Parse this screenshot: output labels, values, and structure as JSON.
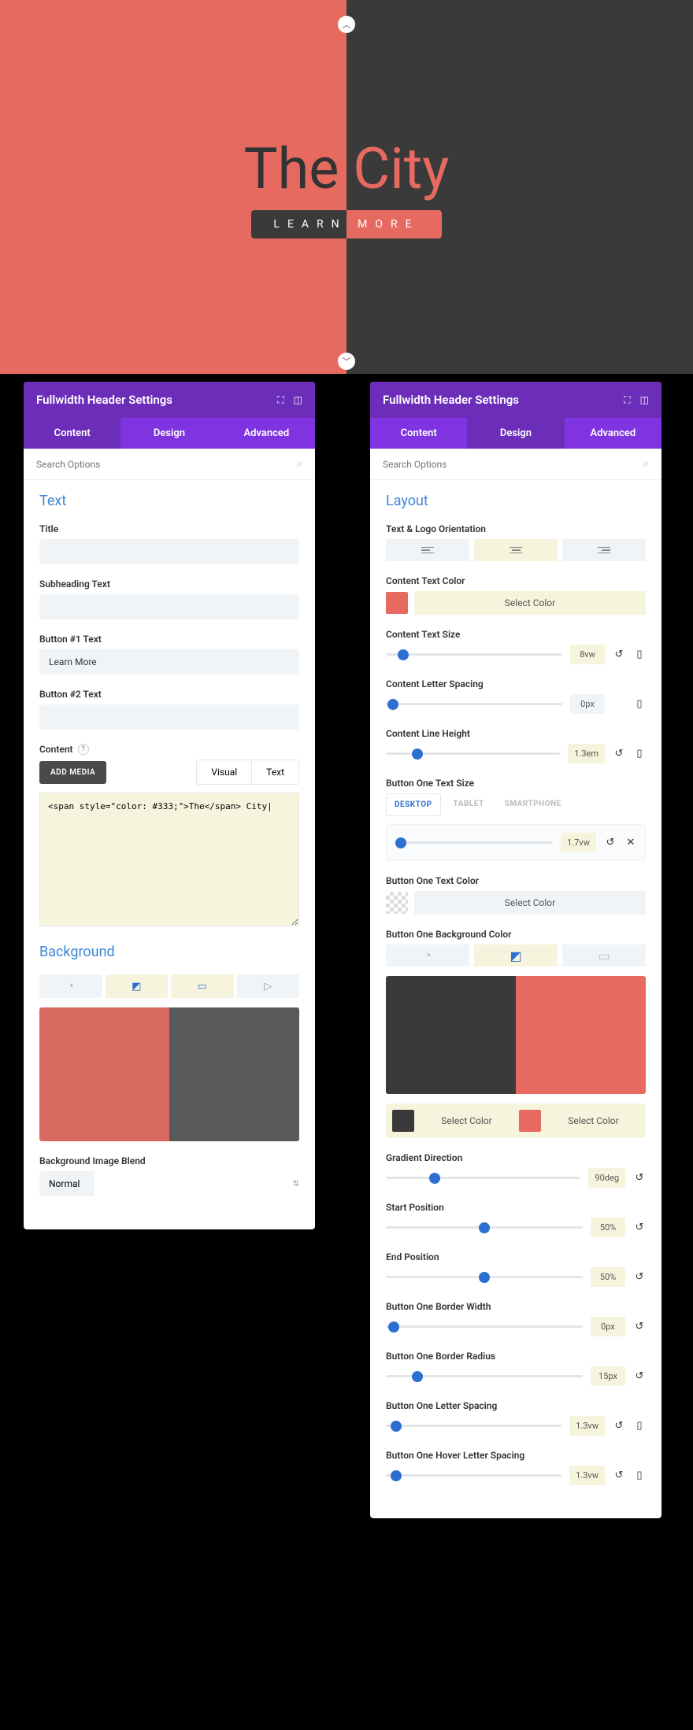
{
  "hero": {
    "title_part1": "The",
    "title_part2": "City",
    "button_label": "Learn More"
  },
  "panel_content": {
    "title": "Fullwidth Header Settings",
    "tabs": {
      "content": "Content",
      "design": "Design",
      "advanced": "Advanced"
    },
    "search_placeholder": "Search Options",
    "section_text": "Text",
    "fields": {
      "title_label": "Title",
      "subheading_label": "Subheading Text",
      "btn1_label": "Button #1 Text",
      "btn1_value": "Learn More",
      "btn2_label": "Button #2 Text",
      "content_label": "Content"
    },
    "editor": {
      "add_media": "ADD MEDIA",
      "tab_visual": "Visual",
      "tab_text": "Text",
      "body": "<span style=\"color: #333;\">The</span> City|"
    },
    "section_bg": "Background",
    "bg_blend_label": "Background Image Blend",
    "bg_blend_value": "Normal"
  },
  "panel_design": {
    "title": "Fullwidth Header Settings",
    "tabs": {
      "content": "Content",
      "design": "Design",
      "advanced": "Advanced"
    },
    "search_placeholder": "Search Options",
    "section_layout": "Layout",
    "orientation_label": "Text & Logo Orientation",
    "content_text_color_label": "Content Text Color",
    "select_color": "Select Color",
    "content_text_size_label": "Content Text Size",
    "content_text_size_value": "8vw",
    "content_letter_spacing_label": "Content Letter Spacing",
    "content_letter_spacing_value": "0px",
    "content_line_height_label": "Content Line Height",
    "content_line_height_value": "1.3em",
    "btn1_text_size_label": "Button One Text Size",
    "device_tabs": {
      "desktop": "DESKTOP",
      "tablet": "TABLET",
      "smartphone": "SMARTPHONE"
    },
    "btn1_text_size_value": "1.7vw",
    "btn1_text_color_label": "Button One Text Color",
    "btn1_bg_color_label": "Button One Background Color",
    "gradient_dir_label": "Gradient Direction",
    "gradient_dir_value": "90deg",
    "start_pos_label": "Start Position",
    "start_pos_value": "50%",
    "end_pos_label": "End Position",
    "end_pos_value": "50%",
    "btn1_border_width_label": "Button One Border Width",
    "btn1_border_width_value": "0px",
    "btn1_border_radius_label": "Button One Border Radius",
    "btn1_border_radius_value": "15px",
    "btn1_letter_spacing_label": "Button One Letter Spacing",
    "btn1_letter_spacing_value": "1.3vw",
    "btn1_hover_letter_spacing_label": "Button One Hover Letter Spacing",
    "btn1_hover_letter_spacing_value": "1.3vw"
  }
}
